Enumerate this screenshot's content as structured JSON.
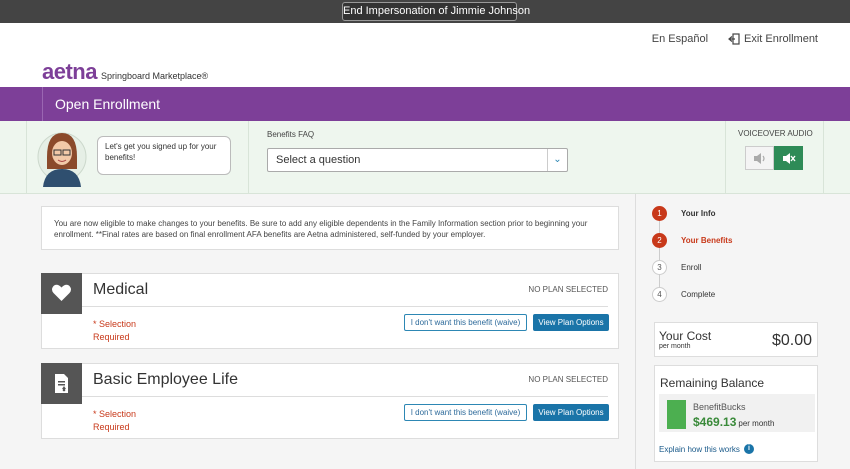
{
  "impersonation": {
    "label": "End Impersonation of Jimmie Johnson"
  },
  "header": {
    "spanish_link": "En Español",
    "exit_link": "Exit Enrollment",
    "logo_word": "aetna",
    "logo_sub": "Springboard Marketplace®"
  },
  "banner": {
    "title": "Open Enrollment"
  },
  "help": {
    "bubble_text": "Let's get you signed up for your benefits!",
    "faq_label": "Benefits FAQ",
    "faq_placeholder": "Select a question",
    "voiceover_label": "VOICEOVER AUDIO"
  },
  "notice": {
    "text": "You are now eligible to make changes to your benefits. Be sure to add any eligible dependents in the Family Information section prior to beginning your enrollment. **Final rates are based on final enrollment AFA benefits are Aetna administered, self-funded by your employer."
  },
  "benefits": [
    {
      "title": "Medical",
      "status": "NO PLAN SELECTED",
      "selection_line1": "* Selection",
      "selection_line2": "Required",
      "waive_label": "I don't want this benefit (waive)",
      "view_label": "View Plan Options",
      "icon": "heart-icon"
    },
    {
      "title": "Basic Employee Life",
      "status": "NO PLAN SELECTED",
      "selection_line1": "* Selection",
      "selection_line2": "Required",
      "waive_label": "I don't want this benefit (waive)",
      "view_label": "View Plan Options",
      "icon": "document-icon"
    }
  ],
  "steps": [
    {
      "num": "1",
      "label": "Your Info",
      "state": "done"
    },
    {
      "num": "2",
      "label": "Your Benefits",
      "state": "active"
    },
    {
      "num": "3",
      "label": "Enroll",
      "state": "pending"
    },
    {
      "num": "4",
      "label": "Complete",
      "state": "pending"
    }
  ],
  "cost": {
    "label": "Your Cost",
    "sub": "per month",
    "value": "$0.00"
  },
  "balance": {
    "title": "Remaining Balance",
    "name": "BenefitBucks",
    "amount": "$469.13",
    "per": "per month",
    "link": "Explain how this works"
  },
  "colors": {
    "brand_purple": "#7d3f98",
    "accent_red": "#c8391a",
    "button_blue": "#1a74a8",
    "balance_green": "#4caf50"
  }
}
